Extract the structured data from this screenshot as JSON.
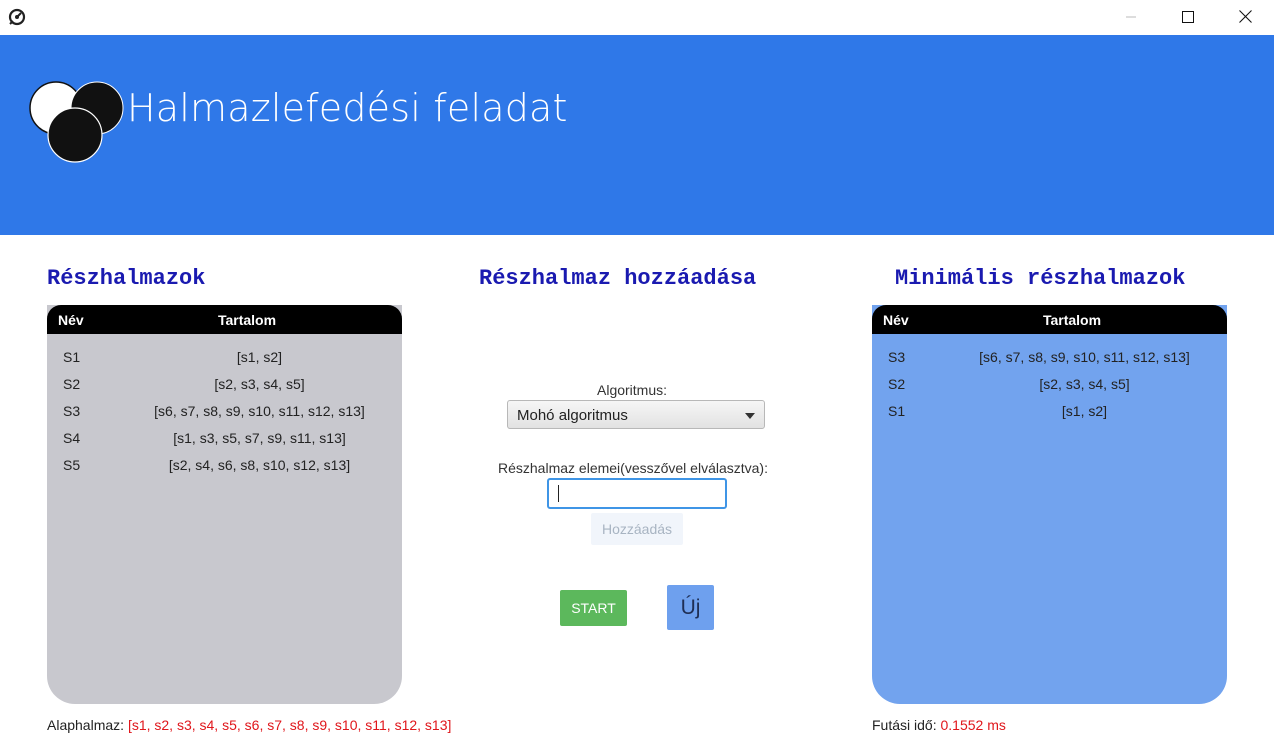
{
  "window": {
    "app_icon": "gear-icon",
    "minimize_icon": "minimize-icon",
    "maximize_icon": "maximize-icon",
    "close_icon": "close-icon"
  },
  "header": {
    "title": "Halmazlefedési feladat",
    "logo": "circles-logo",
    "background": "#2f78e8"
  },
  "left_panel": {
    "heading": "Részhalmazok",
    "columns": {
      "name": "Név",
      "content": "Tartalom"
    },
    "rows": [
      {
        "name": "S1",
        "content": "[s1, s2]"
      },
      {
        "name": "S2",
        "content": "[s2, s3, s4, s5]"
      },
      {
        "name": "S3",
        "content": "[s6, s7, s8, s9, s10, s11, s12, s13]"
      },
      {
        "name": "S4",
        "content": "[s1, s3, s5, s7, s9, s11, s13]"
      },
      {
        "name": "S5",
        "content": "[s2, s4, s6, s8, s10, s12, s13]"
      }
    ],
    "background": "#c8c8ce"
  },
  "center": {
    "heading": "Részhalmaz hozzáadása",
    "algorithm_label": "Algoritmus:",
    "algorithm_selected": "Mohó algoritmus",
    "elements_label": "Részhalmaz elemei(vesszővel elválasztva):",
    "elements_value": "",
    "add_button": "Hozzáadás",
    "start_button": "START",
    "new_button": "Új"
  },
  "right_panel": {
    "heading": "Minimális részhalmazok",
    "columns": {
      "name": "Név",
      "content": "Tartalom"
    },
    "rows": [
      {
        "name": "S3",
        "content": "[s6, s7, s8, s9, s10, s11, s12, s13]"
      },
      {
        "name": "S2",
        "content": "[s2, s3, s4, s5]"
      },
      {
        "name": "S1",
        "content": "[s1, s2]"
      }
    ],
    "background": "#72a3ee"
  },
  "footer": {
    "base_set_label": "Alaphalmaz:",
    "base_set_value": "[s1, s2, s3, s4, s5, s6, s7, s8, s9, s10, s11, s12, s13]",
    "runtime_label": "Futási idő:",
    "runtime_value": "0.1552 ms"
  },
  "colors": {
    "heading": "#1a1ab0",
    "highlight_value": "#e0161b",
    "start": "#5cb85c",
    "new": "#6ea0ee"
  }
}
